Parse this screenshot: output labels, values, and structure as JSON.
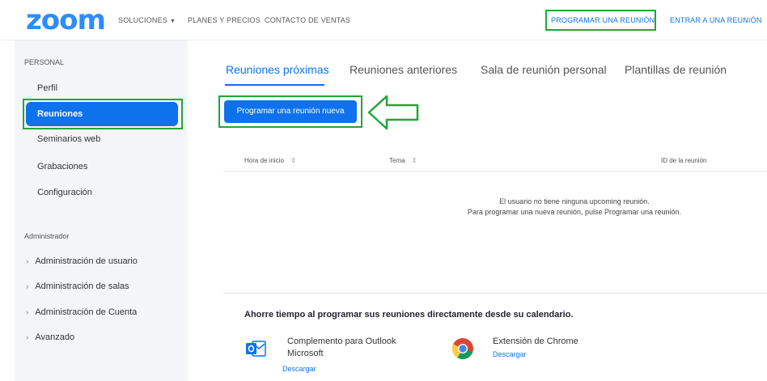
{
  "brand": {
    "logo": "zoom",
    "accent": "#0e72ed",
    "highlight": "#22a63a"
  },
  "topnav": {
    "solutions": "SOLUCIONES",
    "plans": "PLANES Y PRECIOS",
    "contact": "CONTACTO DE VENTAS",
    "schedule": "PROGRAMAR UNA REUNIÓN",
    "join": "ENTRAR A UNA REUNIÓN"
  },
  "sidebar": {
    "personal_header": "PERSONAL",
    "items": [
      "Perfil",
      "Reuniones",
      "Seminarios web",
      "Grabaciones",
      "Configuración"
    ],
    "active_item": "Reuniones",
    "admin_header": "Administrador",
    "admin_items": [
      "Administración de usuario",
      "Administración de salas",
      "Administración de Cuenta",
      "Avanzado"
    ]
  },
  "tabs": [
    "Reuniones próximas",
    "Reuniones anteriores",
    "Sala de reunión personal",
    "Plantillas de reunión"
  ],
  "schedule_button": "Programar una reunión nueva",
  "table": {
    "headers": [
      "Hora de inicio",
      "Tema",
      "ID de la reunión"
    ],
    "sort_icon": "⇕",
    "empty_line1": "El usuario no tiene ninguna upcoming reunión.",
    "empty_line2": "Para programar una nueva reunión, pulse Programar una reunión."
  },
  "calendar": {
    "title": "Ahorre tiempo al programar sus reuniones directamente desde su calendario.",
    "outlook_line1": "Complemento para Outlook",
    "outlook_line2": "Microsoft",
    "outlook_link": "Descargar",
    "chrome_name": "Extensión de Chrome",
    "chrome_link": "Descargar"
  }
}
